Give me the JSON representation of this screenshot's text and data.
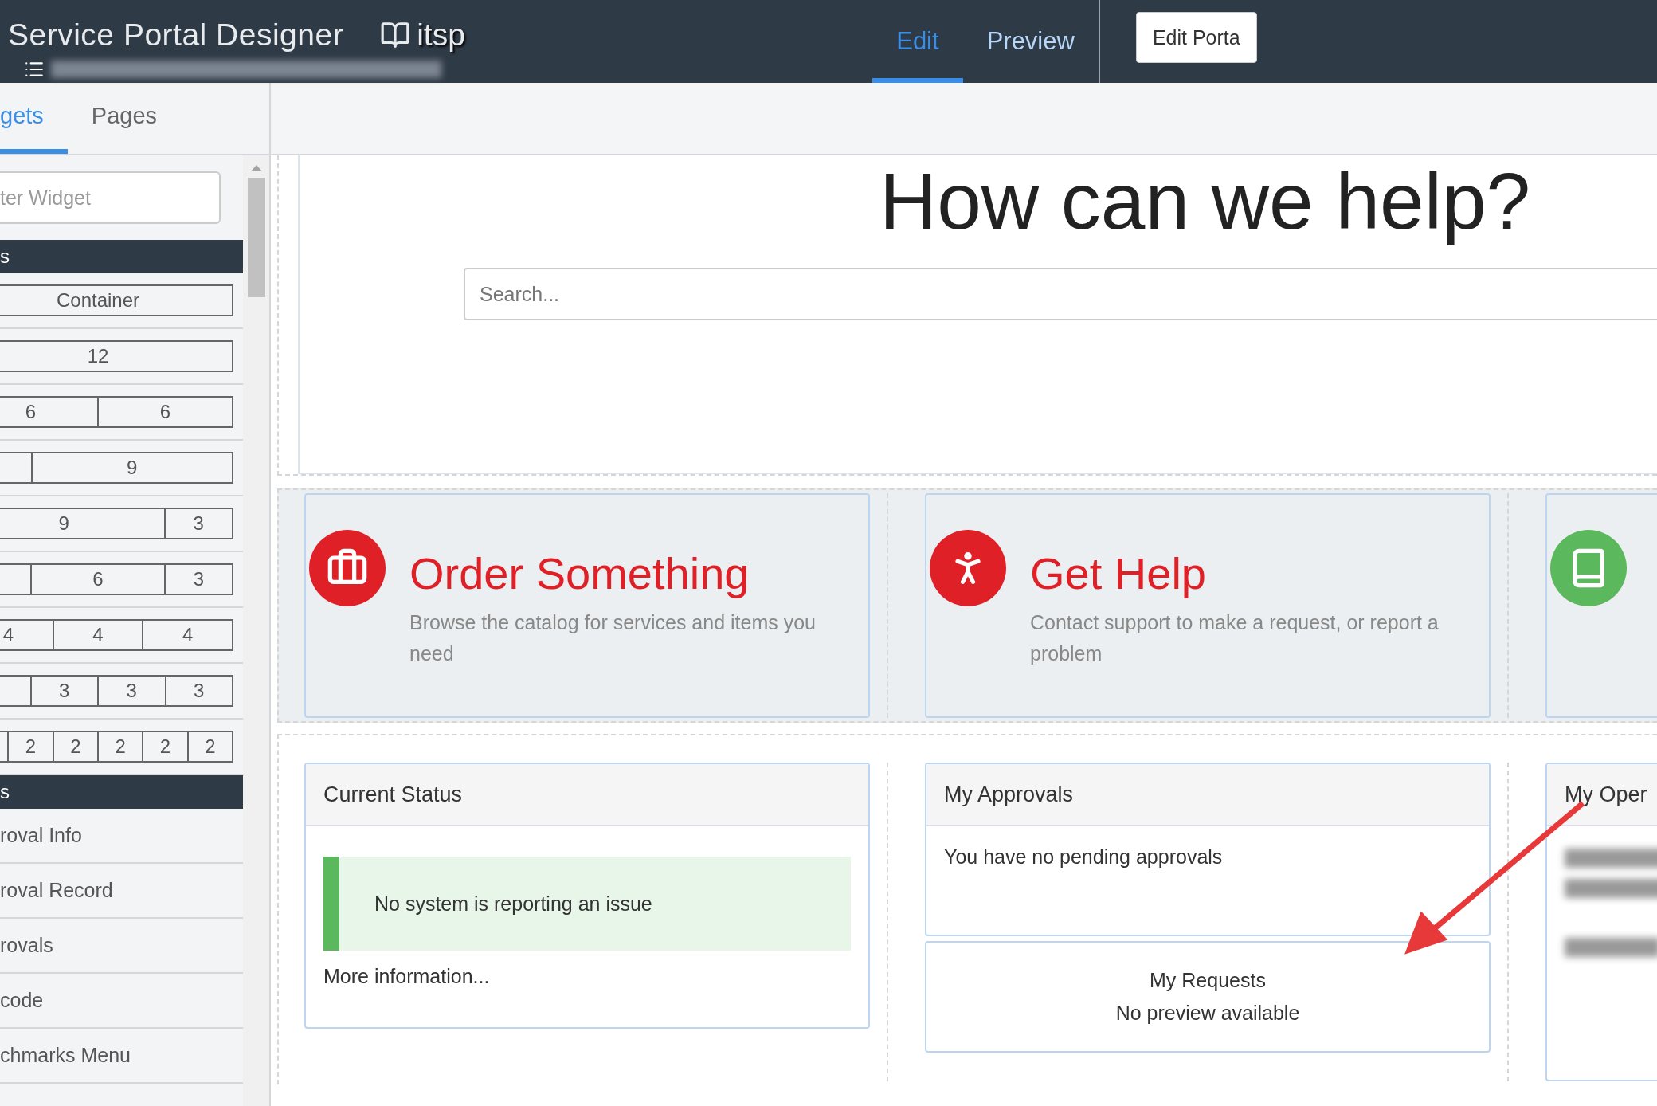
{
  "header": {
    "title": "Service Portal Designer",
    "portal": "itsp",
    "tabs": [
      {
        "label": "Edit",
        "selected": true
      },
      {
        "label": "Preview",
        "selected": false
      }
    ],
    "action": "Edit Porta"
  },
  "sidebar": {
    "tabs": [
      {
        "label": "gets",
        "selected": true
      },
      {
        "label": "Pages",
        "selected": false
      }
    ],
    "filter": {
      "placeholder": "ter Widget"
    },
    "sections": [
      {
        "title": "s",
        "kind": "layouts",
        "presets": [
          {
            "parts": [
              "Container"
            ]
          },
          {
            "parts": [
              "12"
            ]
          },
          {
            "parts": [
              "6",
              "6"
            ]
          },
          {
            "parts": [
              "9"
            ],
            "cut_first": true
          },
          {
            "parts": [
              "9",
              "3"
            ]
          },
          {
            "parts": [
              "6",
              "3"
            ],
            "cut_first": true
          },
          {
            "parts": [
              "4",
              "4",
              "4"
            ]
          },
          {
            "parts": [
              "3",
              "3",
              "3"
            ],
            "cut_first": true
          },
          {
            "parts": [
              "2",
              "2",
              "2",
              "2",
              "2"
            ],
            "cut_first": true
          }
        ]
      },
      {
        "title": "s",
        "kind": "widgets",
        "items": [
          "roval Info",
          "roval Record",
          "rovals",
          "code",
          "chmarks Menu"
        ]
      }
    ]
  },
  "hero": {
    "title": "How can we help?",
    "search": {
      "placeholder": "Search..."
    }
  },
  "cards": [
    {
      "kind": "briefcase",
      "color": "#e02027",
      "title": "Order Something",
      "description": "Browse the catalog for services and items you need"
    },
    {
      "kind": "person",
      "color": "#e02027",
      "title": "Get Help",
      "description": "Contact support to make a request, or report a problem"
    },
    {
      "kind": "book",
      "color": "#5cb85c"
    }
  ],
  "panels": [
    {
      "kind": "status",
      "title": "Current Status",
      "message": "No system is reporting an issue",
      "link": "More information..."
    },
    {
      "kind": "approvals",
      "title": "My Approvals",
      "message": "You have no pending approvals",
      "extra": {
        "title": "My Requests",
        "message": "No preview available"
      }
    },
    {
      "kind": "list",
      "title": "My Oper"
    }
  ]
}
